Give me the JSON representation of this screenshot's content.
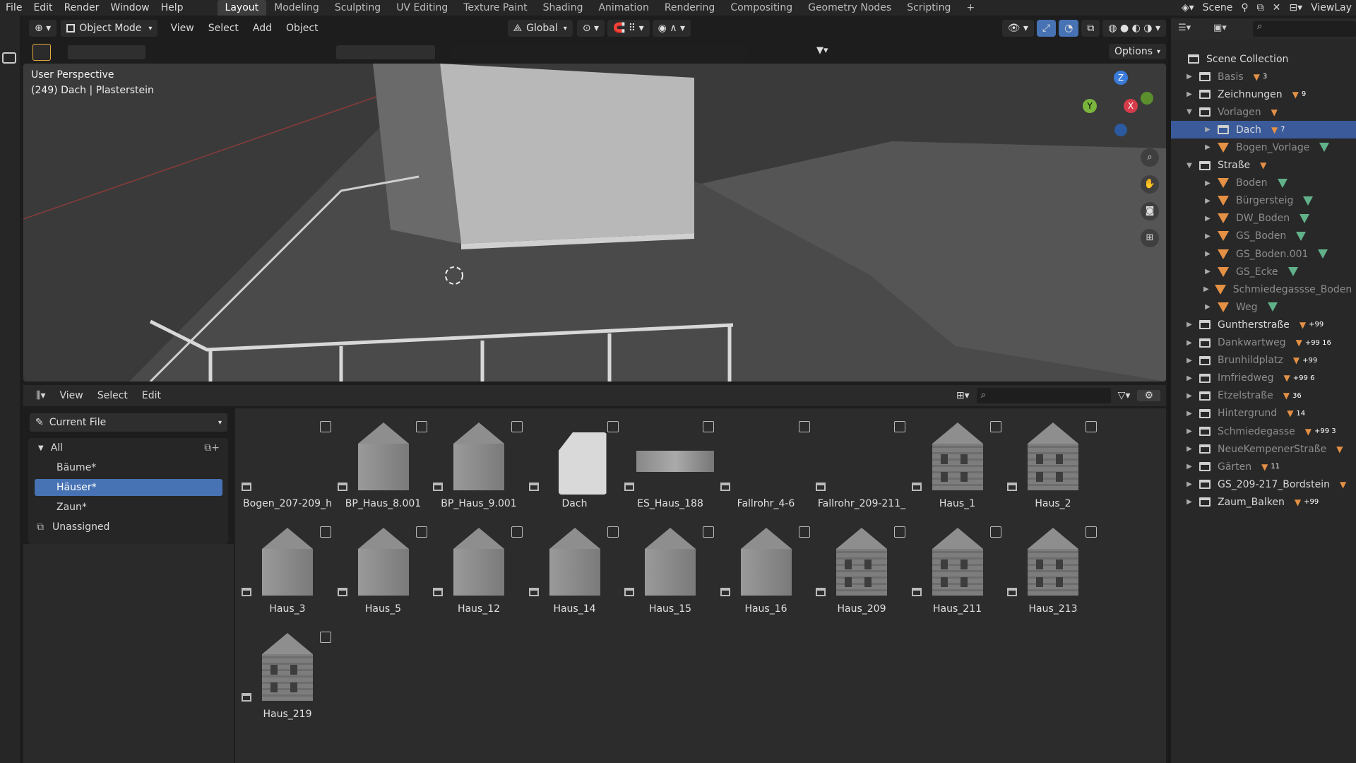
{
  "topbar": {
    "menus": [
      "File",
      "Edit",
      "Render",
      "Window",
      "Help"
    ],
    "workspaces": [
      "Layout",
      "Modeling",
      "Sculpting",
      "UV Editing",
      "Texture Paint",
      "Shading",
      "Animation",
      "Rendering",
      "Compositing",
      "Geometry Nodes",
      "Scripting",
      "+"
    ],
    "active_workspace": "Layout",
    "scene": "Scene",
    "view_layer": "ViewLay"
  },
  "viewport": {
    "mode": "Object Mode",
    "menus": [
      "View",
      "Select",
      "Add",
      "Object"
    ],
    "transform_orientation": "Global",
    "options": "Options",
    "perspective_label": "User Perspective",
    "object_label": "(249) Dach | Plasterstein",
    "gizmo_axes": [
      "Z",
      "Y",
      "X"
    ]
  },
  "outliner": {
    "root": "Scene Collection",
    "rows": [
      {
        "label": "Basis",
        "kind": "collection",
        "expanded": false,
        "dim": true,
        "indent": 0,
        "badge": "3"
      },
      {
        "label": "Zeichnungen",
        "kind": "collection",
        "expanded": false,
        "dim": false,
        "indent": 0,
        "badge": "9"
      },
      {
        "label": "Vorlagen",
        "kind": "collection",
        "expanded": true,
        "dim": true,
        "indent": 0,
        "badge": ""
      },
      {
        "label": "Dach",
        "kind": "collection",
        "expanded": false,
        "dim": true,
        "indent": 1,
        "badge": "7",
        "selected": true
      },
      {
        "label": "Bogen_Vorlage",
        "kind": "mesh",
        "expanded": false,
        "dim": true,
        "indent": 1,
        "badge": ""
      },
      {
        "label": "Straße",
        "kind": "collection",
        "expanded": true,
        "dim": false,
        "indent": 0,
        "badge": ""
      },
      {
        "label": "Boden",
        "kind": "mesh",
        "expanded": false,
        "dim": true,
        "indent": 1,
        "badge": ""
      },
      {
        "label": "Bürgersteig",
        "kind": "mesh",
        "expanded": false,
        "dim": true,
        "indent": 1,
        "badge": ""
      },
      {
        "label": "DW_Boden",
        "kind": "mesh",
        "expanded": false,
        "dim": true,
        "indent": 1,
        "badge": ""
      },
      {
        "label": "GS_Boden",
        "kind": "mesh",
        "expanded": false,
        "dim": true,
        "indent": 1,
        "badge": ""
      },
      {
        "label": "GS_Boden.001",
        "kind": "mesh",
        "expanded": false,
        "dim": true,
        "indent": 1,
        "badge": ""
      },
      {
        "label": "GS_Ecke",
        "kind": "mesh",
        "expanded": false,
        "dim": true,
        "indent": 1,
        "badge": ""
      },
      {
        "label": "Schmiedegassse_Boden",
        "kind": "mesh",
        "expanded": false,
        "dim": true,
        "indent": 1,
        "badge": ""
      },
      {
        "label": "Weg",
        "kind": "mesh",
        "expanded": false,
        "dim": true,
        "indent": 1,
        "badge": ""
      },
      {
        "label": "Guntherstraße",
        "kind": "collection",
        "expanded": false,
        "dim": false,
        "indent": 0,
        "badge": "+99"
      },
      {
        "label": "Dankwartweg",
        "kind": "collection",
        "expanded": false,
        "dim": true,
        "indent": 0,
        "badge": "+99 16"
      },
      {
        "label": "Brunhildplatz",
        "kind": "collection",
        "expanded": false,
        "dim": true,
        "indent": 0,
        "badge": "+99"
      },
      {
        "label": "Irnfriedweg",
        "kind": "collection",
        "expanded": false,
        "dim": true,
        "indent": 0,
        "badge": "+99 6"
      },
      {
        "label": "Etzelstraße",
        "kind": "collection",
        "expanded": false,
        "dim": true,
        "indent": 0,
        "badge": "36"
      },
      {
        "label": "Hintergrund",
        "kind": "collection",
        "expanded": false,
        "dim": true,
        "indent": 0,
        "badge": "14"
      },
      {
        "label": "Schmiedegasse",
        "kind": "collection",
        "expanded": false,
        "dim": true,
        "indent": 0,
        "badge": "+99 3"
      },
      {
        "label": "NeueKempenerStraße",
        "kind": "collection",
        "expanded": false,
        "dim": true,
        "indent": 0,
        "badge": ""
      },
      {
        "label": "Gärten",
        "kind": "collection",
        "expanded": false,
        "dim": true,
        "indent": 0,
        "badge": "11"
      },
      {
        "label": "GS_209-217_Bordstein",
        "kind": "collection",
        "expanded": false,
        "dim": false,
        "indent": 0,
        "badge": ""
      },
      {
        "label": "Zaum_Balken",
        "kind": "collection",
        "expanded": false,
        "dim": false,
        "indent": 0,
        "badge": "+99"
      }
    ]
  },
  "asset_browser": {
    "menus": [
      "View",
      "Select",
      "Edit"
    ],
    "library": "Current File",
    "categories": [
      {
        "label": "All",
        "selected": false
      },
      {
        "label": "Bäume*",
        "selected": false
      },
      {
        "label": "Häuser*",
        "selected": true
      },
      {
        "label": "Zaun*",
        "selected": false
      },
      {
        "label": "Unassigned",
        "selected": false
      }
    ],
    "assets": [
      {
        "name": "Bogen_207-209_h",
        "thumb": "empty"
      },
      {
        "name": "BP_Haus_8.001",
        "thumb": "house"
      },
      {
        "name": "BP_Haus_9.001",
        "thumb": "house"
      },
      {
        "name": "Dach",
        "thumb": "doc"
      },
      {
        "name": "ES_Haus_188",
        "thumb": "flat"
      },
      {
        "name": "Fallrohr_4-6",
        "thumb": "empty"
      },
      {
        "name": "Fallrohr_209-211_",
        "thumb": "empty"
      },
      {
        "name": "Haus_1",
        "thumb": "house-tex"
      },
      {
        "name": "Haus_2",
        "thumb": "house-tex"
      },
      {
        "name": "Haus_3",
        "thumb": "house"
      },
      {
        "name": "Haus_5",
        "thumb": "house"
      },
      {
        "name": "Haus_12",
        "thumb": "house"
      },
      {
        "name": "Haus_14",
        "thumb": "house"
      },
      {
        "name": "Haus_15",
        "thumb": "house"
      },
      {
        "name": "Haus_16",
        "thumb": "house"
      },
      {
        "name": "Haus_209",
        "thumb": "house-tex"
      },
      {
        "name": "Haus_211",
        "thumb": "house-tex"
      },
      {
        "name": "Haus_213",
        "thumb": "house-tex"
      },
      {
        "name": "Haus_219",
        "thumb": "house-tex"
      }
    ]
  }
}
